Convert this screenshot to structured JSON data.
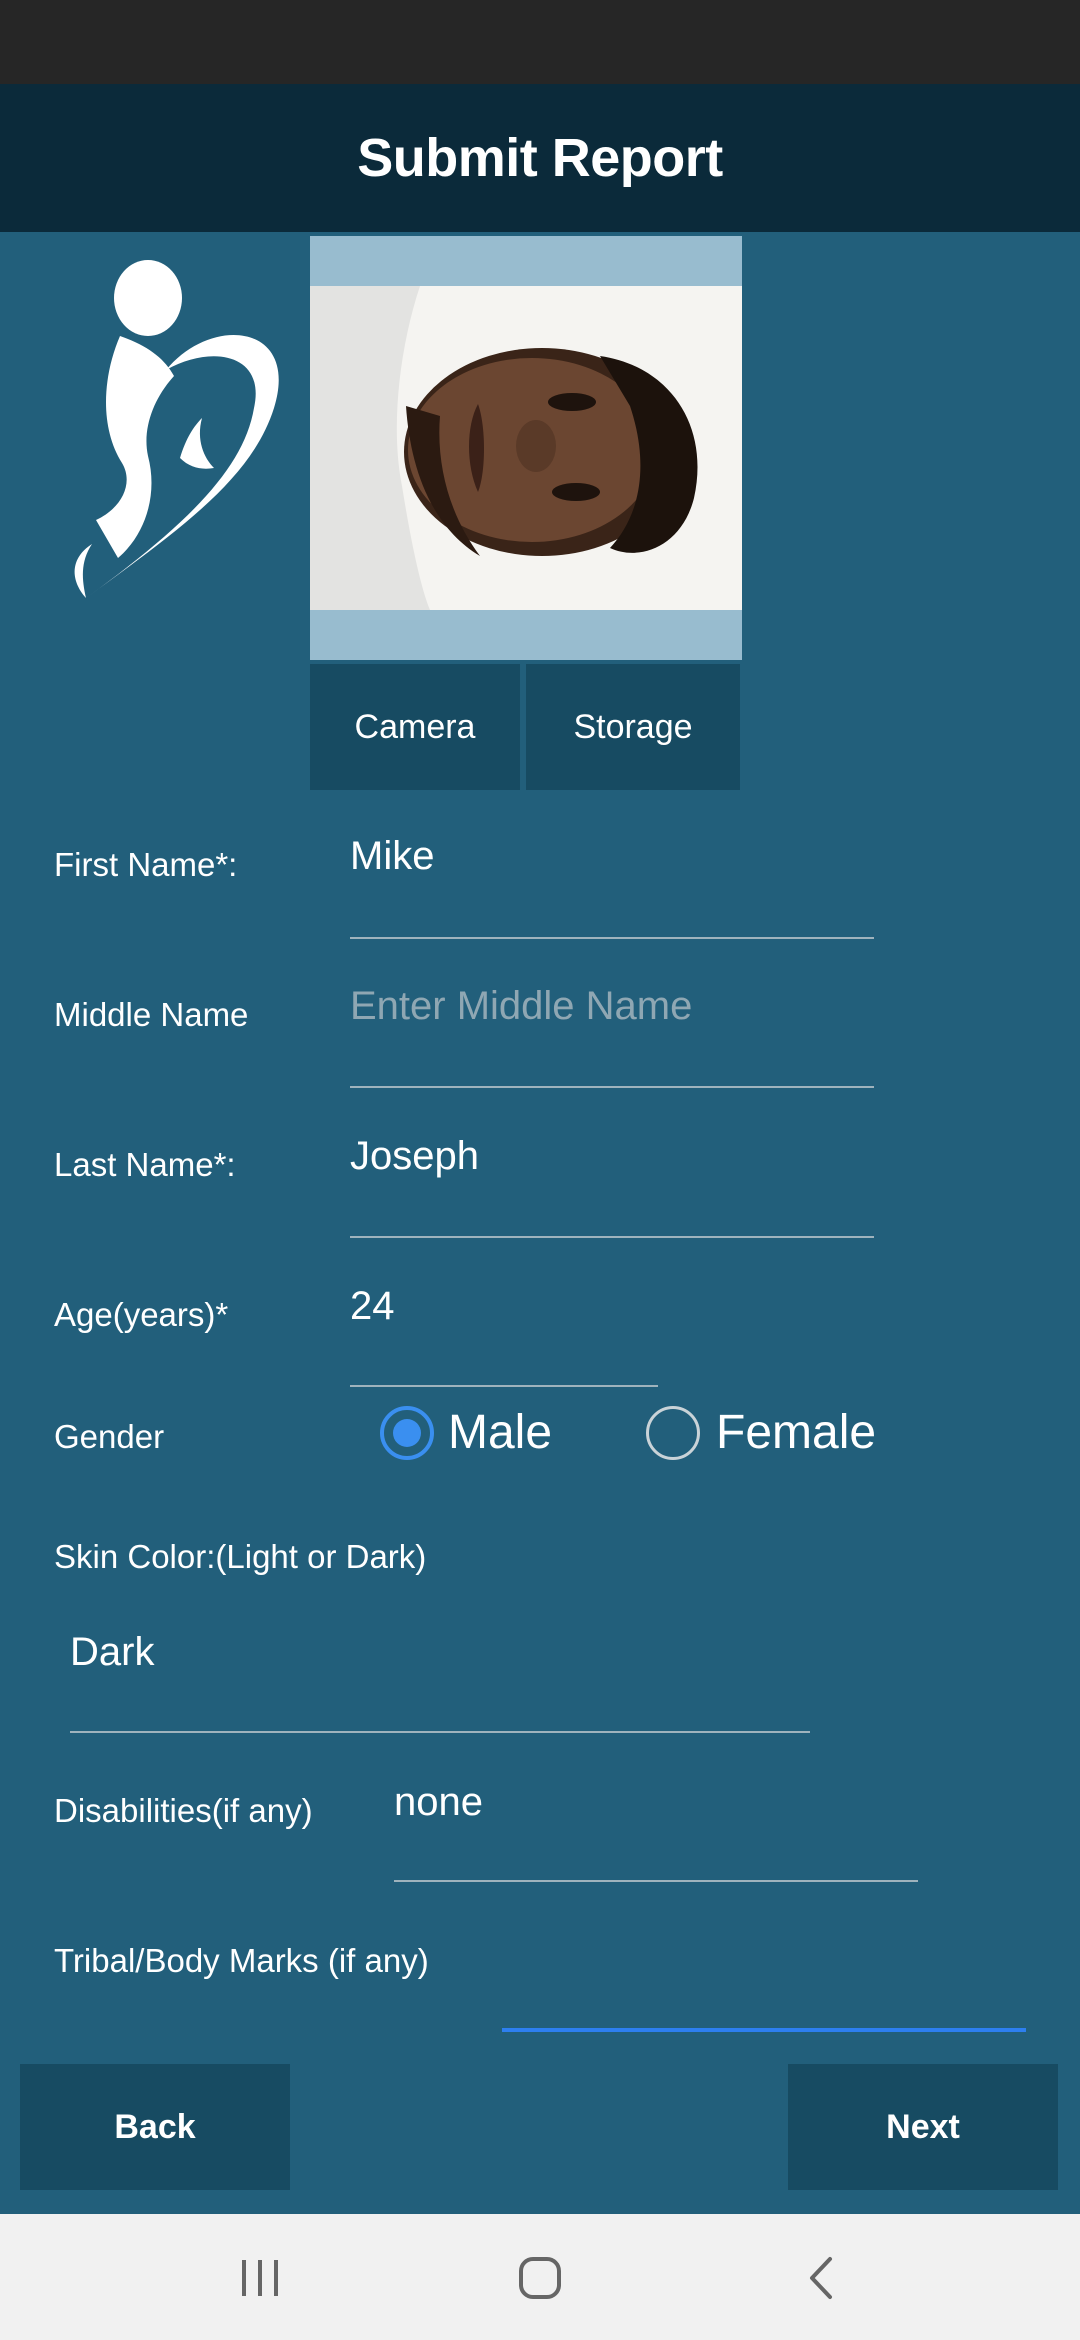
{
  "header": {
    "title": "Submit Report"
  },
  "photo": {
    "camera_label": "Camera",
    "storage_label": "Storage"
  },
  "form": {
    "first_name": {
      "label": "First Name*:",
      "value": "Mike"
    },
    "middle_name": {
      "label": "Middle Name",
      "placeholder": "Enter Middle Name"
    },
    "last_name": {
      "label": "Last Name*:",
      "value": "Joseph"
    },
    "age": {
      "label": "Age(years)*",
      "value": "24"
    },
    "gender": {
      "label": "Gender",
      "options": [
        "Male",
        "Female"
      ],
      "selected": "Male"
    },
    "skin_color": {
      "label": "Skin Color:(Light or Dark)",
      "value": "Dark"
    },
    "disabilities": {
      "label": "Disabilities(if any)",
      "value": "none"
    },
    "tribal_marks": {
      "label": "Tribal/Body Marks (if any)",
      "value": ""
    }
  },
  "actions": {
    "back_label": "Back",
    "next_label": "Next"
  },
  "system_nav": {
    "icons": [
      "recents-icon",
      "home-icon",
      "back-icon"
    ]
  },
  "colors": {
    "background": "#225f7b",
    "header": "#0b2a3a",
    "button": "#174b62",
    "accent": "#3a8ff0"
  }
}
